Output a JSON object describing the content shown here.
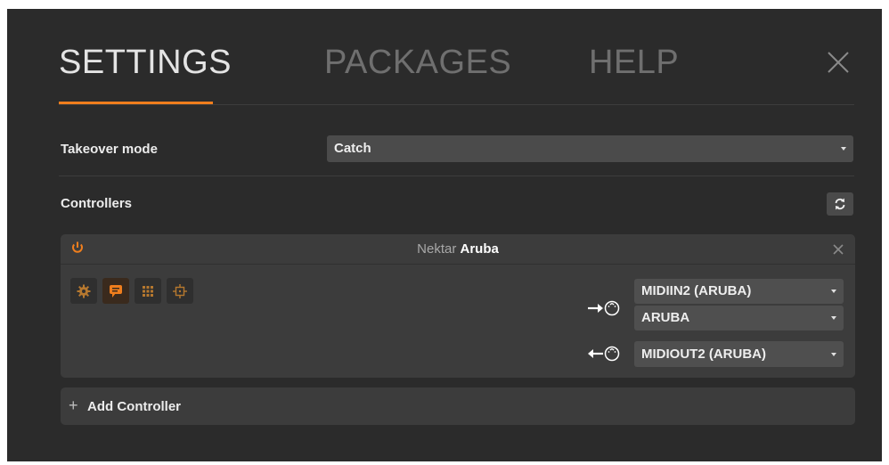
{
  "tabs": {
    "settings": "SETTINGS",
    "packages": "PACKAGES",
    "help": "HELP"
  },
  "takeover": {
    "label": "Takeover mode",
    "value": "Catch"
  },
  "controllers": {
    "label": "Controllers",
    "card": {
      "vendor": "Nektar",
      "model": "Aruba",
      "midi_in_ports": [
        "MIDIIN2 (ARUBA)",
        "ARUBA"
      ],
      "midi_out_port": "MIDIOUT2 (ARUBA)"
    },
    "add_label": "Add Controller",
    "add_symbol": "+"
  },
  "colors": {
    "accent": "#f07e1d",
    "background": "#2b2b2b",
    "panel": "#3c3c3c",
    "select": "#4b4b4b"
  },
  "icons": [
    "close-icon",
    "refresh-icon",
    "power-icon",
    "gear-icon",
    "chat-icon",
    "grid-icon",
    "crosshair-icon",
    "midi-in-icon",
    "midi-out-icon"
  ]
}
